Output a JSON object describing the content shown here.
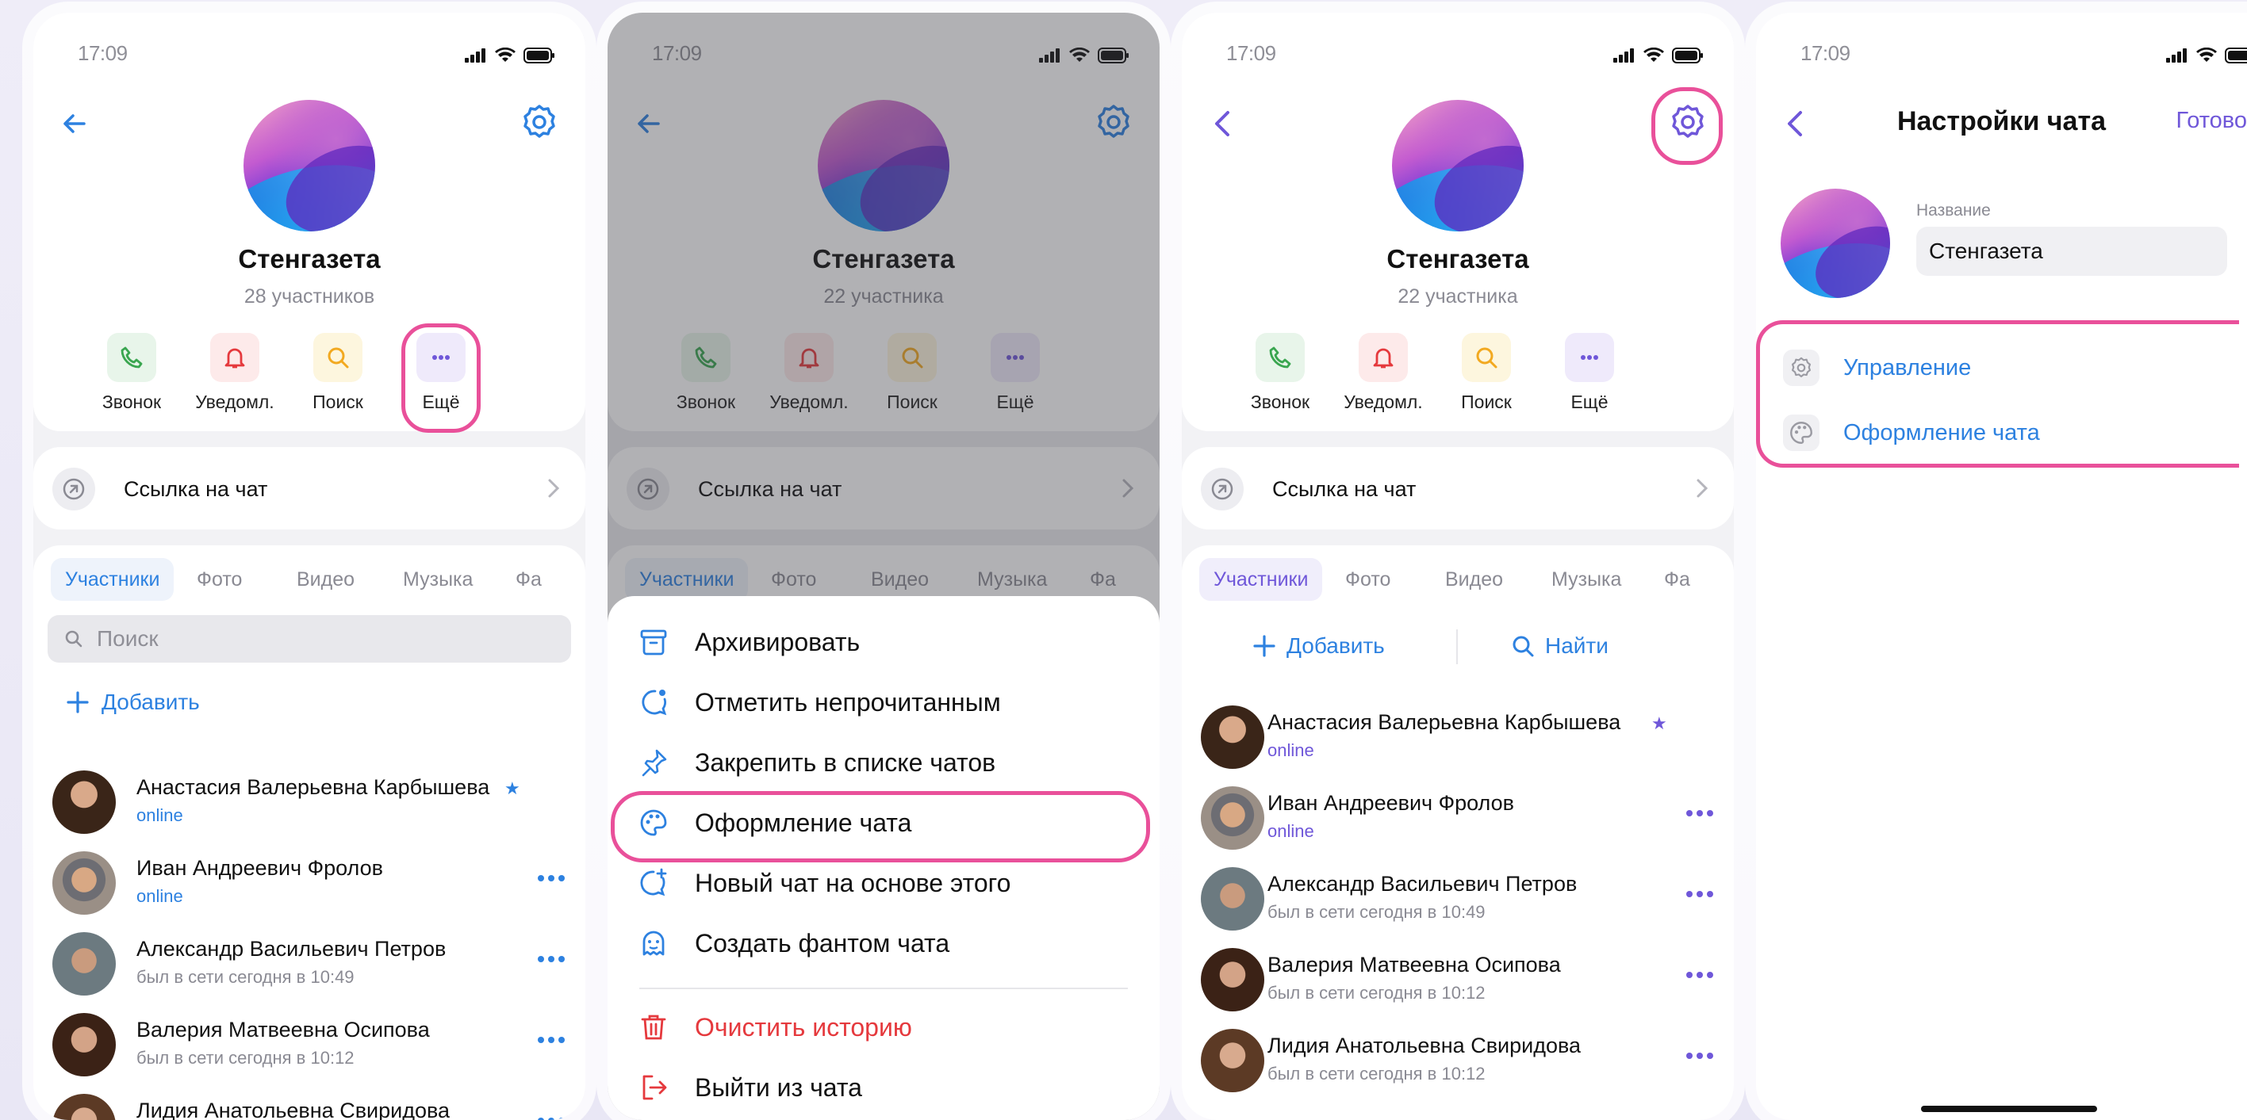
{
  "status": {
    "time": "17:09"
  },
  "chat": {
    "name": "Стенгазета",
    "members_a": "28 участников",
    "members_b": "22 участника"
  },
  "actions": {
    "call": "Звонок",
    "notify": "Уведомл.",
    "search": "Поиск",
    "more": "Ещё"
  },
  "link_label": "Ссылка на чат",
  "tabs": [
    "Участники",
    "Фото",
    "Видео",
    "Музыка",
    "Фа"
  ],
  "search_placeholder": "Поиск",
  "add_label": "Добавить",
  "find_label": "Найти",
  "people": [
    {
      "name": "Анастасия Валерьевна Карбышева",
      "status": "online"
    },
    {
      "name": "Иван Андреевич Фролов",
      "status": "online"
    },
    {
      "name": "Александр Васильевич Петров",
      "status": "был в сети сегодня в 10:49"
    },
    {
      "name": "Валерия Матвеевна Осипова",
      "status": "был в сети сегодня в 10:12"
    },
    {
      "name": "Лидия Анатольевна Свиридова",
      "status": "был в сети сегодня в 10:12"
    }
  ],
  "menu": {
    "archive": "Архивировать",
    "mark_unread": "Отметить непрочитанным",
    "pin": "Закрепить в списке чатов",
    "appearance": "Оформление чата",
    "new_chat": "Новый чат на основе этого",
    "phantom": "Создать фантом чата",
    "clear": "Очистить историю",
    "leave": "Выйти из чата"
  },
  "settings": {
    "title": "Настройки чата",
    "done": "Готово",
    "name_label": "Название",
    "name_value": "Стенгазета",
    "manage": "Управление",
    "appearance": "Оформление чата"
  },
  "colors": {
    "accent": "#2d81e0",
    "highlight": "#e9509a",
    "danger": "#e5393d",
    "purple": "#6f57d9"
  }
}
